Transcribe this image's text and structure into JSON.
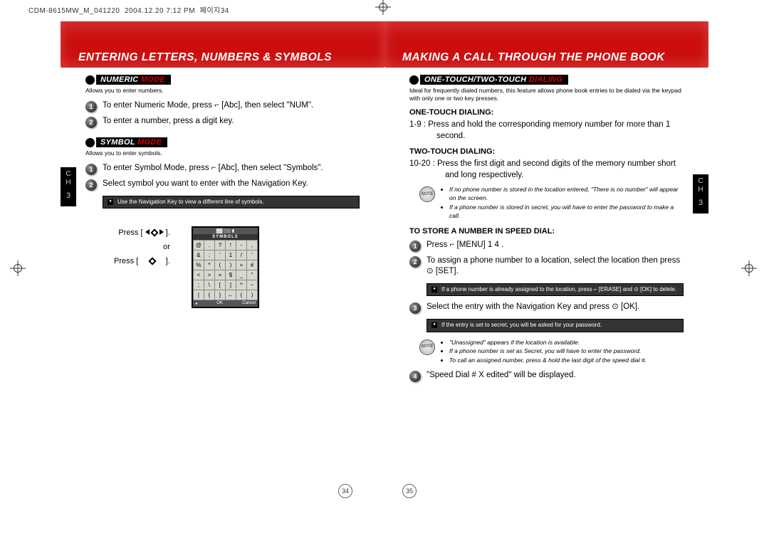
{
  "header_line": "CDM-8615MW_M_041220  2004.12.20 7:12 PM  페이지34",
  "left": {
    "title": "ENTERING LETTERS, NUMBERS & SYMBOLS",
    "section1": {
      "label": "NUMERIC",
      "mode": "MODE",
      "sub": "Allows you to enter numbers."
    },
    "s1step1": "To enter Numeric Mode, press ⌐ [Abc], then select \"NUM\".",
    "s1step2": "To enter a number, press a digit key.",
    "section2": {
      "label": "SYMBOL",
      "mode": "MODE",
      "sub": "Allows you to enter symbols."
    },
    "s2step1": "To enter Symbol Mode, press ⌐ [Abc], then select \"Symbols\".",
    "s2step2": "Select symbol you want to enter with the Navigation Key.",
    "infobox1": "Use the Navigation Key to view a different line of symbols.",
    "press1": "Press [",
    "press_or": "or",
    "press2": "Press [",
    "press_close": "].",
    "symbols_title": "SYMBOLS",
    "symbols_grid": [
      [
        "@",
        ".",
        "?",
        "!",
        "-",
        ","
      ],
      [
        "&",
        ":",
        "'",
        "1",
        "/",
        "'"
      ],
      [
        "%",
        "*",
        "(",
        ")",
        "+",
        "#"
      ],
      [
        "<",
        ">",
        "=",
        "$",
        "_",
        "\""
      ],
      [
        ";",
        "\\",
        "[",
        "]",
        "^",
        "~"
      ],
      [
        "|",
        "{",
        "}",
        "←",
        "(",
        ")"
      ]
    ],
    "ok": "OK",
    "cancel": "Cancel",
    "page_num": "34",
    "ch": "C\nH",
    "chnum": "3"
  },
  "right": {
    "title": "MAKING A CALL THROUGH THE PHONE BOOK",
    "section1": {
      "label": "ONE-TOUCH/TWO-TOUCH",
      "mode": "DIALING"
    },
    "sec1_sub": "Ideal for frequently dialed numbers, this feature allows phone book entries to be dialed via the keypad with only one or two key presses.",
    "one_touch_head": "ONE-TOUCH DIALING:",
    "one_touch_body": "1-9 : Press and hold the corresponding memory number for more than 1 second.",
    "two_touch_head": "TWO-TOUCH DIALING:",
    "two_touch_body": "10-20 : Press the first digit and second digits of the memory number short and long respectively.",
    "note1_a": "If no phone number is stored in the location entered, \"There is no number\" will appear on the screen.",
    "note1_b": "If a phone number is stored in secret, you will have to enter the password to make a call.",
    "store_head": "TO STORE A NUMBER IN SPEED DIAL:",
    "store1": "Press ⌐ [MENU] 1 4 .",
    "store2": "To assign a phone number to a location, select the location then press ⊙ [SET].",
    "info2a": "If a phone number is already assigned to the location, press ⌐ [ERASE] and ⊙ [OK] to delete.",
    "store3": "Select the entry with the Navigation Key and press ⊙ [OK].",
    "info3": "If the entry is set to secret, you will be asked for your password.",
    "note2_a": "\"Unassigned\" appears if the location is available.",
    "note2_b": "If a phone number is set as Secret, you will have to enter the password.",
    "note2_c": "To call an assigned number, press & hold the last digit of the speed dial #.",
    "store4": "\"Speed Dial # X edited\" will be displayed.",
    "page_num": "35",
    "ch": "C\nH",
    "chnum": "3"
  }
}
